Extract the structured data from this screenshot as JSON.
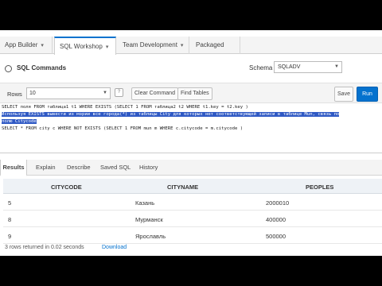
{
  "tabs": [
    {
      "label": "App Builder",
      "active": false
    },
    {
      "label": "SQL Workshop",
      "active": true
    },
    {
      "label": "Team Development",
      "active": false
    },
    {
      "label": "Packaged Apps",
      "active": false
    }
  ],
  "header": {
    "title": "SQL Commands",
    "schema_label": "Schema",
    "schema_value": "SQLADV"
  },
  "controls": {
    "rows_label": "Rows",
    "rows_value": "10",
    "clear_label": "Clear Command",
    "find_label": "Find Tables",
    "save_label": "Save",
    "run_label": "Run"
  },
  "editor": {
    "line1": "SELECT поля FROM таблица1 t1 WHERE EXISTS (SELECT 1 FROM таблица2 t2 WHERE t1.key = t2.key )",
    "line2": "Используя EXISTS вывести из мэрии все города(*) из таблицы City для которых нет соответствующей записи в таблице Mun,  связь по",
    "line3": "полю Citycode",
    "line4": "SELECT * FROM city c WHERE NOT EXISTS (SELECT 1 FROM mun m WHERE c.citycode = m.citycode )"
  },
  "result_tabs": [
    "Results",
    "Explain",
    "Describe",
    "Saved SQL",
    "History"
  ],
  "results": {
    "columns": [
      "CITYCODE",
      "CITYNAME",
      "PEOPLES"
    ],
    "rows": [
      [
        "5",
        "Казань",
        "2000010"
      ],
      [
        "8",
        "Мурманск",
        "400000"
      ],
      [
        "9",
        "Ярославль",
        "500000"
      ]
    ],
    "footer": "3 rows returned in 0.02 seconds",
    "download": "Download"
  },
  "colors": {
    "accent": "#0572ce",
    "selection": "#2f59c4"
  }
}
